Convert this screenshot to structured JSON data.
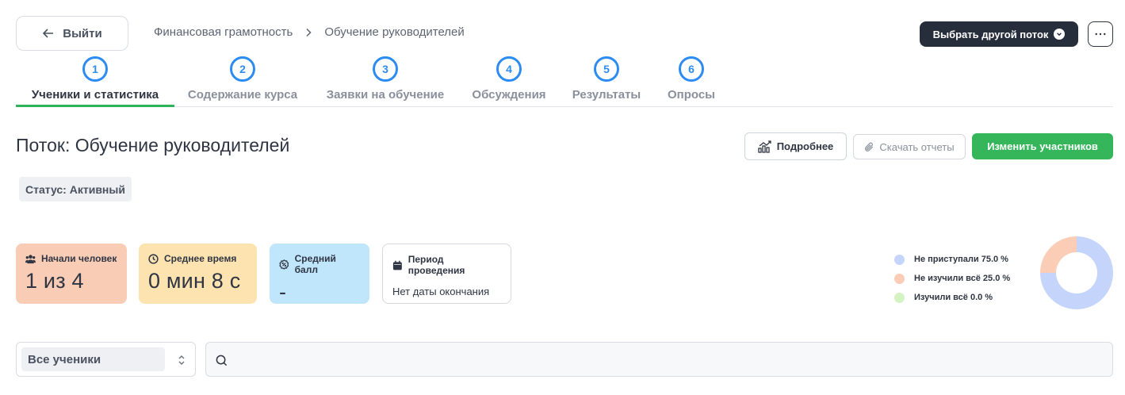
{
  "topbar": {
    "back_label": "Выйти",
    "breadcrumb": [
      "Финансовая грамотность",
      "Обучение руководителей"
    ],
    "stream_button": "Выбрать другой поток",
    "more_icon": "more-horizontal-icon"
  },
  "tabs": [
    {
      "num": "1",
      "label": "Ученики и статистика",
      "active": true
    },
    {
      "num": "2",
      "label": "Содержание курса",
      "active": false
    },
    {
      "num": "3",
      "label": "Заявки на обучение",
      "active": false
    },
    {
      "num": "4",
      "label": "Обсуждения",
      "active": false
    },
    {
      "num": "5",
      "label": "Результаты",
      "active": false
    },
    {
      "num": "6",
      "label": "Опросы",
      "active": false
    }
  ],
  "page": {
    "title": "Поток: Обучение руководителей",
    "details_button": "Подробнее",
    "report_button": "Скачать отчеты",
    "members_button": "Изменить участников",
    "status": "Статус: Активный"
  },
  "stats": [
    {
      "label": "Начали человек",
      "value": "1 из 4",
      "icon": "users-icon",
      "color": "#f9ccb5"
    },
    {
      "label": "Среднее время",
      "value": "0 мин 8 с",
      "icon": "clock-icon",
      "color": "#fce3b0"
    },
    {
      "label": "Средний балл",
      "value": "-",
      "icon": "score-icon",
      "color": "#c0e6fb"
    },
    {
      "label": "Период проведения",
      "value": "Нет даты окончания",
      "icon": "calendar-icon",
      "color": "#ffffff"
    }
  ],
  "chart_data": {
    "type": "pie",
    "categories": [
      "Не приступали",
      "Не изучили всё",
      "Изучили всё"
    ],
    "values": [
      75.0,
      25.0,
      0.0
    ],
    "legend_labels": [
      "Не приступали 75.0 %",
      "Не изучили всё 25.0 %",
      "Изучили всё 0.0 %"
    ],
    "colors": [
      "#c4d4fb",
      "#fbcdb7",
      "#d4f2c2"
    ],
    "legend": "left"
  },
  "filters": {
    "select_value": "Все ученики",
    "search_placeholder": ""
  }
}
